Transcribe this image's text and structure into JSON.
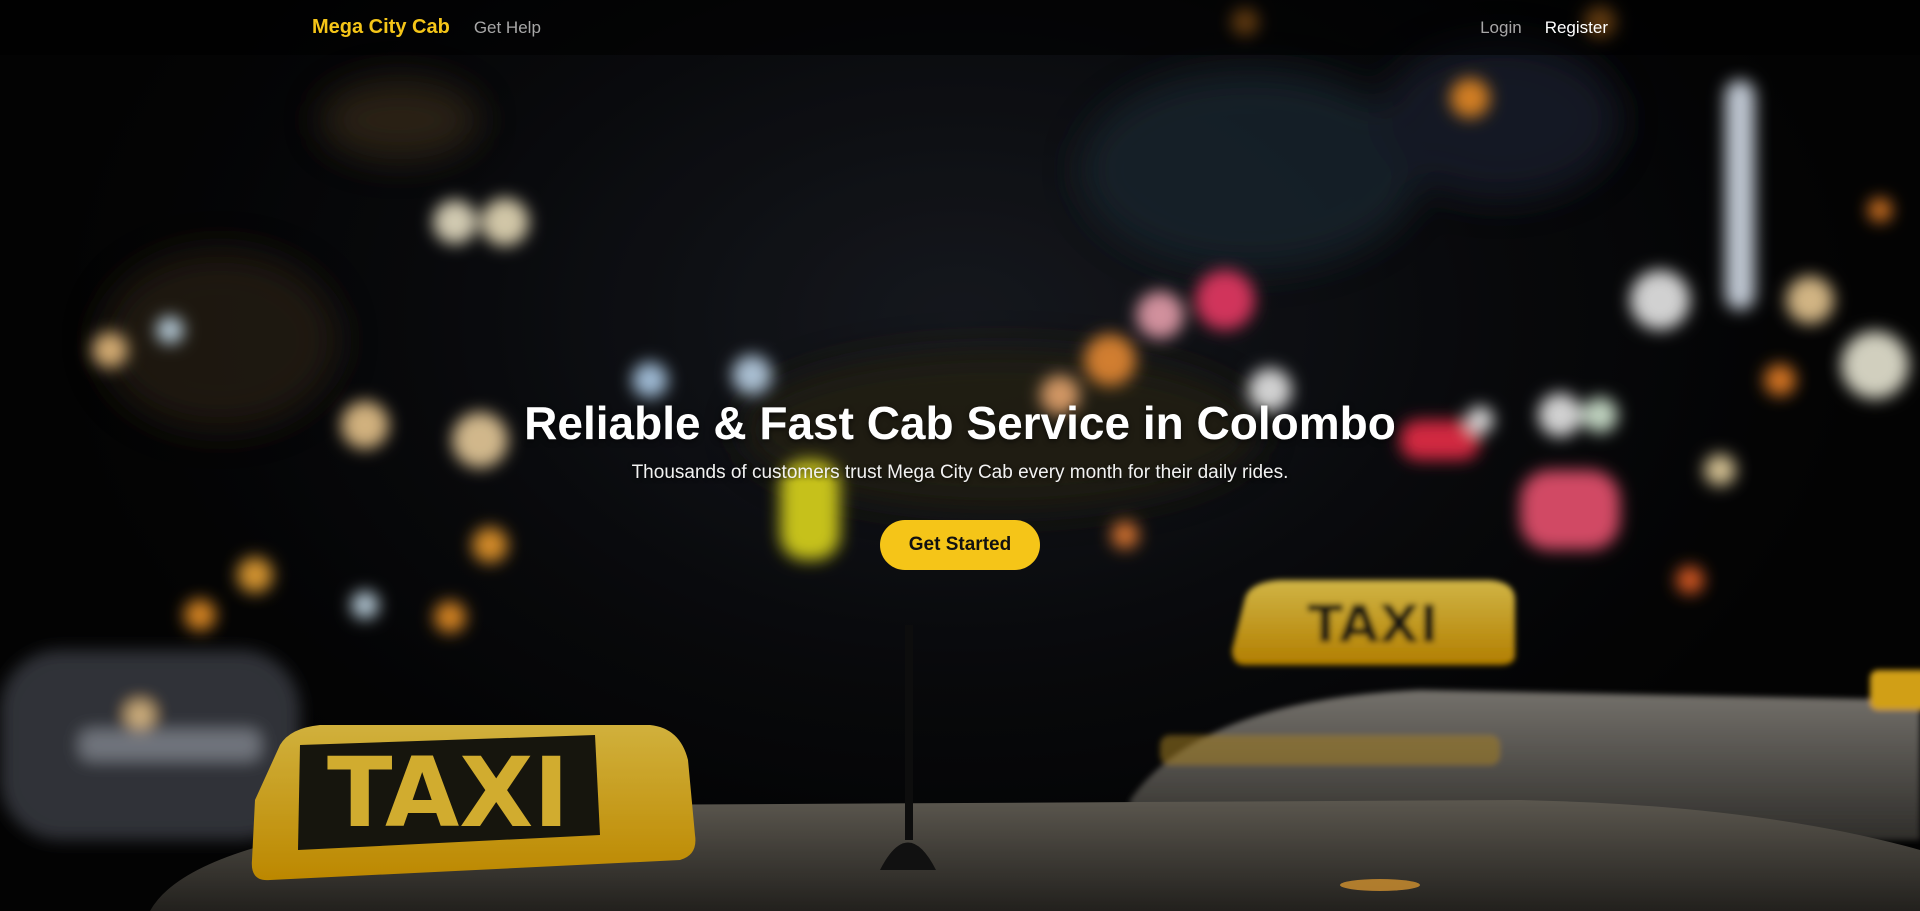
{
  "navbar": {
    "brand": "Mega City Cab",
    "help_link": "Get Help",
    "login_link": "Login",
    "register_link": "Register"
  },
  "hero": {
    "title": "Reliable & Fast Cab Service in Colombo",
    "subtitle": "Thousands of customers trust Mega City Cab every month for their daily rides.",
    "cta_label": "Get Started",
    "background_image": {
      "sign_text_front": "TAXI",
      "sign_text_back": "TAXI"
    }
  },
  "colors": {
    "accent": "#f5c518",
    "nav_text": "#a7a7a7",
    "background": "#050505"
  }
}
